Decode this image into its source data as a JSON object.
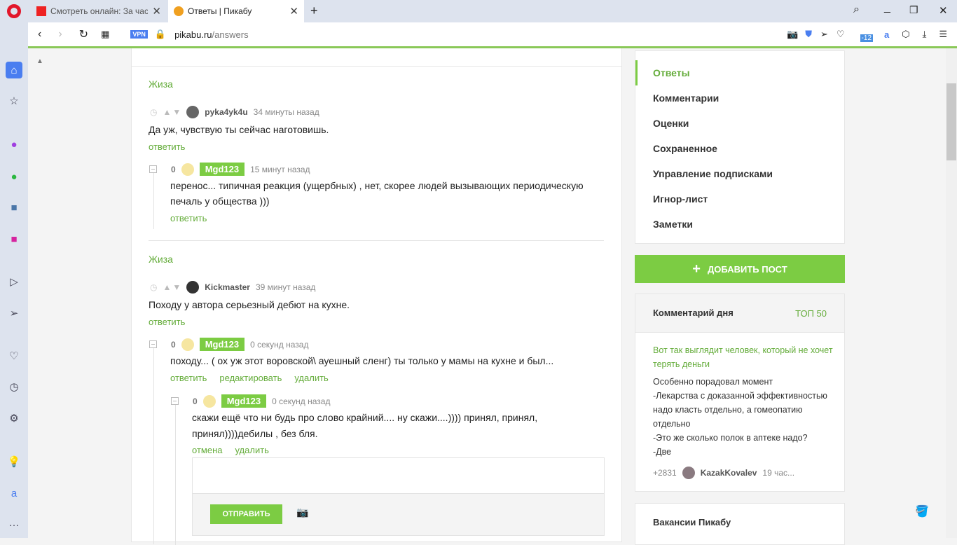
{
  "browser": {
    "tabs": [
      {
        "label": "Смотреть онлайн: За час д"
      },
      {
        "label": "Ответы | Пикабу"
      }
    ],
    "vpn": "VPN",
    "url_host": "pikabu.ru",
    "url_path": "/answers",
    "ext_badge": "-12"
  },
  "comments": [
    {
      "tag": "Жиза",
      "author": "pyka4yk4u",
      "time": "34 минуты назад",
      "text": "Да уж, чувствую ты сейчас наготовишь.",
      "reply": "ответить",
      "child": {
        "rating": "0",
        "author": "Mgd123",
        "time": "15 минут назад",
        "text": "перенос... типичная реакция  (ущербных) , нет, скорее людей вызывающих периодическую печаль у общества )))",
        "reply": "ответить"
      }
    },
    {
      "tag": "Жиза",
      "author": "Kickmaster",
      "time": "39 минут назад",
      "text": "Походу у автора серьезный дебют на кухне.",
      "reply": "ответить",
      "child": {
        "rating": "0",
        "author": "Mgd123",
        "time": "0 секунд назад",
        "text": "походу...  ( ох уж этот воровской\\ ауешный сленг) ты только у мамы на кухне и был...",
        "actions": [
          "ответить",
          "редактировать",
          "удалить"
        ],
        "child": {
          "rating": "0",
          "author": "Mgd123",
          "time": "0 секунд назад",
          "text": "скажи ещё что ни будь про слово крайний.... ну скажи....)))) принял, принял, принял))))дебилы , без бля.",
          "actions": [
            "отмена",
            "удалить"
          ],
          "submit": "ОТПРАВИТЬ"
        }
      }
    }
  ],
  "menu": [
    "Ответы",
    "Комментарии",
    "Оценки",
    "Сохраненное",
    "Управление подписками",
    "Игнор-лист",
    "Заметки"
  ],
  "add_post": "ДОБАВИТЬ ПОСТ",
  "comment_of_day": {
    "title": "Комментарий дня",
    "top": "ТОП 50",
    "post": "Вот так выглядит человек, который не хочет терять деньги",
    "text": "Особенно порадовал момент\n-Лекарства с доказанной эффективностью надо класть отдельно, а гомеопатию отдельно\n-Это же сколько полок в аптеке надо?\n-Две",
    "rating": "+2831",
    "author": "KazakKovalev",
    "time": "19 час..."
  },
  "vacancies": "Вакансии Пикабу"
}
